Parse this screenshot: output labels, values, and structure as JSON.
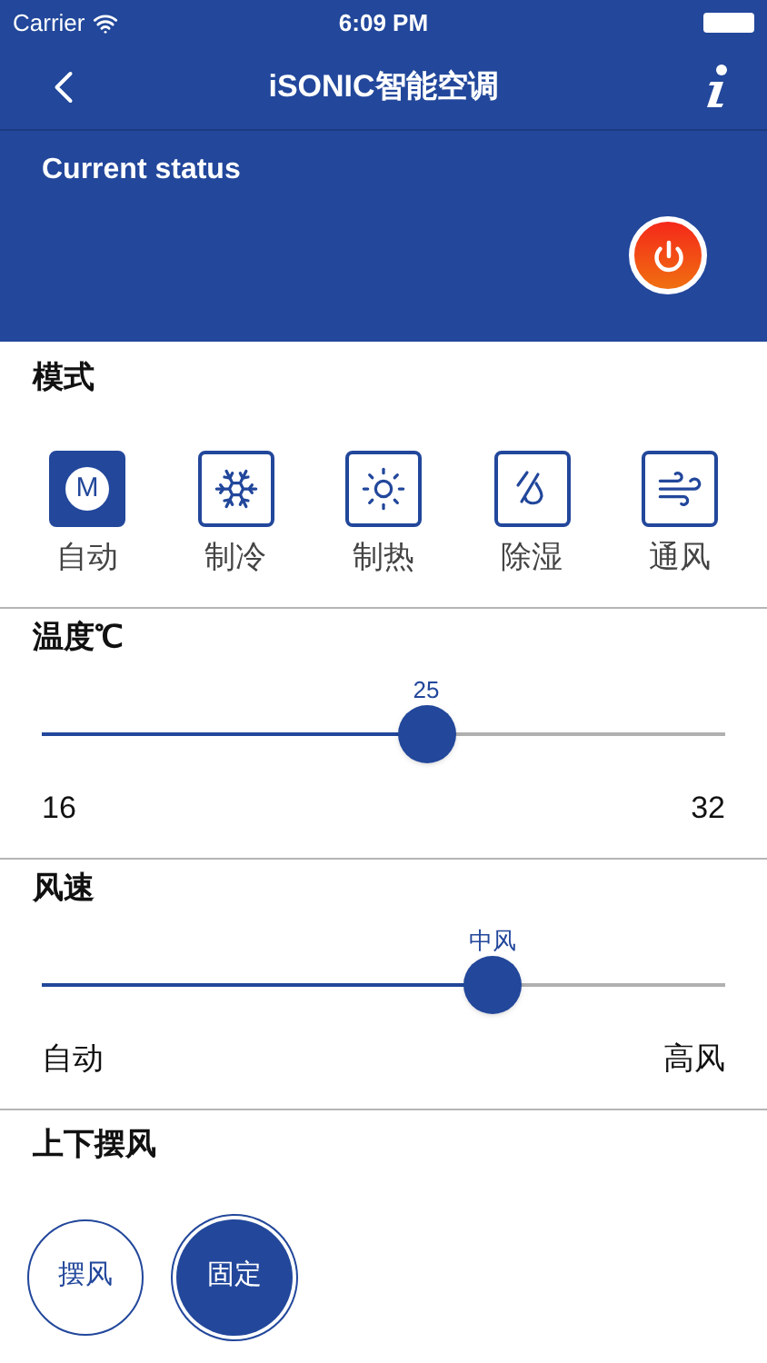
{
  "status_bar": {
    "carrier": "Carrier",
    "time": "6:09 PM"
  },
  "nav": {
    "title": "iSONIC智能空调"
  },
  "current_status": {
    "title": "Current status",
    "power_on": true
  },
  "mode": {
    "title": "模式",
    "items": [
      {
        "kind": "auto",
        "badge": "M",
        "label": "自动",
        "selected": true
      },
      {
        "kind": "cool",
        "label": "制冷",
        "selected": false
      },
      {
        "kind": "heat",
        "label": "制热",
        "selected": false
      },
      {
        "kind": "dry",
        "label": "除湿",
        "selected": false
      },
      {
        "kind": "fan",
        "label": "通风",
        "selected": false
      }
    ]
  },
  "sliders": [
    {
      "title": "温度℃",
      "value": "25",
      "level": 0.5625,
      "min": "16",
      "max": "32"
    },
    {
      "title": "风速",
      "value": "中风",
      "level": 0.66,
      "min": "自动",
      "max": "高风"
    }
  ],
  "swing": {
    "title": "上下摆风",
    "options": [
      {
        "label": "摆风",
        "selected": false
      },
      {
        "label": "固定",
        "selected": true
      }
    ]
  }
}
